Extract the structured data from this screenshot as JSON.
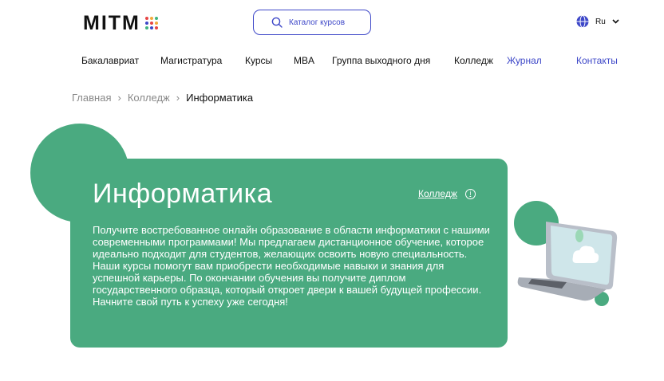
{
  "logo": {
    "text": "MITM",
    "dot_colors": [
      "#e64545",
      "#f2a93b",
      "#3fb37f",
      "#3d47c8",
      "#e64545",
      "#f2a93b",
      "#3fb37f",
      "#3d47c8",
      "#e64545"
    ]
  },
  "search": {
    "label": "Каталог курсов"
  },
  "language": {
    "label": "Ru"
  },
  "nav": {
    "items": [
      {
        "label": "Бакалавриат"
      },
      {
        "label": "Магистратура"
      },
      {
        "label": "Курсы"
      },
      {
        "label": "MBA"
      },
      {
        "label": "Группа выходного дня"
      },
      {
        "label": "Колледж"
      },
      {
        "label": "Журнал"
      },
      {
        "label": "Контакты"
      }
    ]
  },
  "breadcrumb": {
    "home": "Главная",
    "section": "Колледж",
    "current": "Информатика"
  },
  "hero": {
    "title": "Информатика",
    "link": "Колледж",
    "description": "Получите востребованное онлайн образование в области информатики с нашими современными программами! Мы предлагаем дистанционное обучение, которое идеально подходит для студентов, желающих освоить новую специальность. Наши курсы помогут вам приобрести необходимые навыки и знания для успешной карьеры. По окончании обучения вы получите диплом государственного образца, который откроет двери к вашей будущей профессии. Начните свой путь к успеху уже сегодня!"
  },
  "colors": {
    "accent": "#3d47c8",
    "green": "#4aaa80"
  }
}
